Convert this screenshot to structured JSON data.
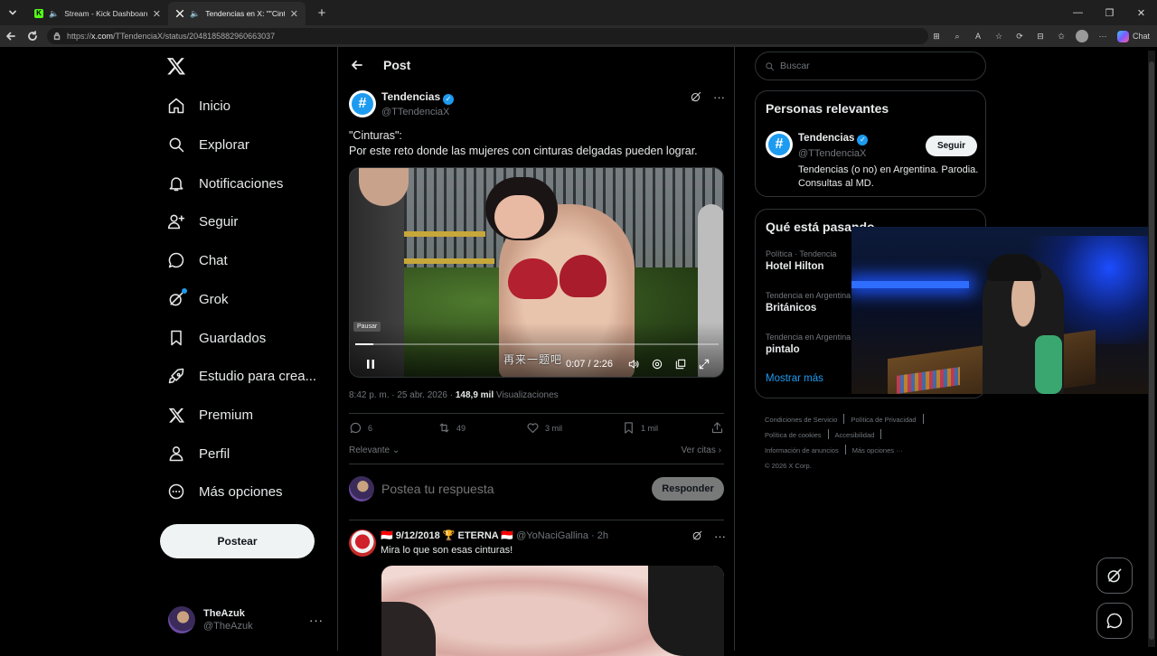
{
  "browser": {
    "tabs": [
      {
        "title": "Stream - Kick Dashboard",
        "active": false
      },
      {
        "title": "Tendencias en X: \"\"Cinturas\": F",
        "active": true
      }
    ],
    "url_prefix": "https://",
    "url_host": "x.com",
    "url_path": "/TTendenciaX/status/2048185882960663037",
    "chat_label": "Chat"
  },
  "nav": {
    "items": [
      {
        "label": "Inicio",
        "icon": "home-icon"
      },
      {
        "label": "Explorar",
        "icon": "search-icon"
      },
      {
        "label": "Notificaciones",
        "icon": "bell-icon"
      },
      {
        "label": "Seguir",
        "icon": "follow-icon"
      },
      {
        "label": "Chat",
        "icon": "chat-icon"
      },
      {
        "label": "Grok",
        "icon": "grok-icon"
      },
      {
        "label": "Guardados",
        "icon": "bookmark-icon"
      },
      {
        "label": "Estudio para crea...",
        "icon": "rocket-icon"
      },
      {
        "label": "Premium",
        "icon": "x-logo-icon"
      },
      {
        "label": "Perfil",
        "icon": "person-icon"
      },
      {
        "label": "Más opciones",
        "icon": "more-circle-icon"
      }
    ],
    "post_button": "Postear",
    "account": {
      "name": "TheAzuk",
      "handle": "@TheAzuk"
    }
  },
  "post": {
    "header_title": "Post",
    "author_name": "Tendencias",
    "author_handle": "@TTendenciaX",
    "text_line1": "\"Cinturas\":",
    "text_line2": "Por este reto donde las mujeres con cinturas delgadas pueden lograr.",
    "video": {
      "tooltip": "Pausar",
      "time": "0:07 / 2:26",
      "progress": 0.05,
      "subtitle": "再来一题吧"
    },
    "timestamp": "8:42 p. m. · 25 abr. 2026 · ",
    "views_count": "148,9 mil",
    "views_label": "Visualizaciones",
    "stats": {
      "replies": "6",
      "reposts": "49",
      "likes": "3 mil",
      "bookmarks": "1 mil"
    },
    "sort_label": "Relevante",
    "quotes_label": "Ver citas"
  },
  "reply_box": {
    "placeholder": "Postea tu respuesta",
    "button": "Responder"
  },
  "reply": {
    "name": "🇮🇩 9/12/2018 🏆 ETERNA 🇮🇩",
    "handle": "@YoNaciGallina · 2h",
    "text": "Mira lo que son esas cinturas!"
  },
  "sidebar": {
    "search_placeholder": "Buscar",
    "relevant_title": "Personas relevantes",
    "person": {
      "name": "Tendencias",
      "handle": "@TTendenciaX",
      "bio": "Tendencias (o no) en Argentina. Parodia. Consultas al MD.",
      "follow": "Seguir"
    },
    "trending_title": "Qué está pasando",
    "trends": [
      {
        "context": "Política · Tendencia",
        "name": "Hotel Hilton"
      },
      {
        "context": "Tendencia en Argentina",
        "name": "Británicos"
      },
      {
        "context": "Tendencia en Argentina",
        "name": "pintalo"
      }
    ],
    "show_more": "Mostrar más",
    "footer": {
      "links": [
        "Condiciones de Servicio",
        "Política de Privacidad",
        "Política de cookies",
        "Accesibilidad",
        "Información de anuncios",
        "Más opciones ···"
      ],
      "copyright": "© 2026 X Corp."
    }
  },
  "colors": {
    "accent": "#1d9bf0",
    "background": "#000000",
    "border": "#2f3336",
    "muted": "#71767b"
  }
}
